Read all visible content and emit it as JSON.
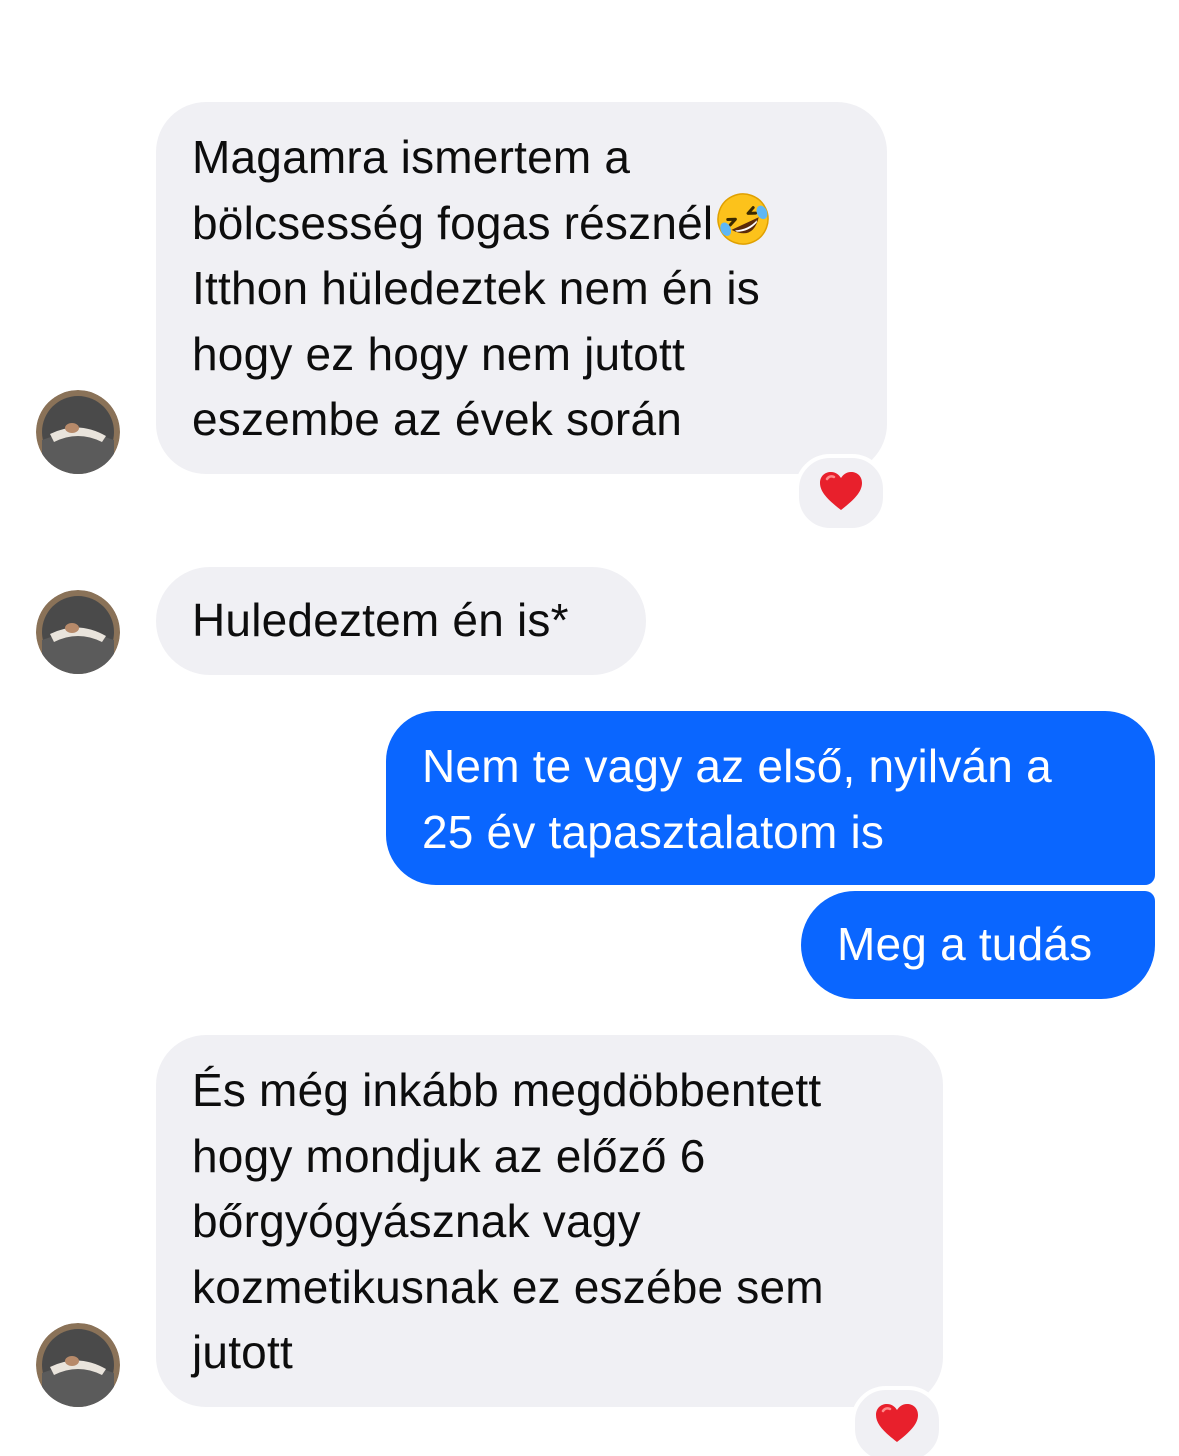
{
  "messages": [
    {
      "direction": "incoming",
      "lines": [
        "Magamra ismertem a",
        "bölcsesség fogas résznél",
        "Itthon hüledeztek nem én is",
        "hogy ez hogy nem jutott",
        "eszembe az évek során"
      ],
      "emoji": "rolling-on-floor-laughing",
      "reaction": "red-heart"
    },
    {
      "direction": "incoming",
      "lines": [
        "Huledeztem én is*"
      ]
    },
    {
      "direction": "outgoing",
      "lines": [
        "Nem te vagy az első, nyilván a",
        "25 év tapasztalatom is"
      ]
    },
    {
      "direction": "outgoing",
      "lines": [
        "Meg a tudás"
      ]
    },
    {
      "direction": "incoming",
      "lines": [
        "És még inkább megdöbbentett",
        "hogy mondjuk az előző 6",
        "bőrgyógyásznak vagy",
        "kozmetikusnak ez eszébe sem",
        "jutott"
      ],
      "reaction": "red-heart"
    }
  ],
  "colors": {
    "incoming_bubble": "#f0f0f4",
    "outgoing_bubble": "#0a66ff",
    "incoming_text": "#0d0d0d",
    "outgoing_text": "#ffffff",
    "heart": "#e8202c"
  }
}
